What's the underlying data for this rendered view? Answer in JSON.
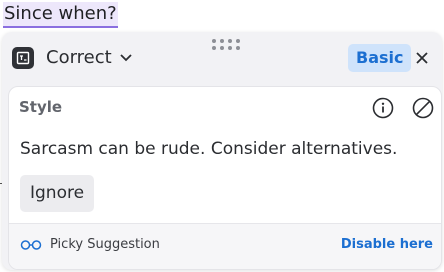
{
  "source_text": "Since when?",
  "popup": {
    "mode_label": "Correct",
    "mode_icon": "writing-tool-icon",
    "plan_badge": "Basic",
    "card": {
      "title": "Style",
      "message": "Sarcasm can be rude. Consider alternatives.",
      "ignore_label": "Ignore",
      "icons": [
        "info-icon",
        "disable-icon"
      ]
    },
    "footer": {
      "label": "Picky Suggestion",
      "icon": "glasses-icon",
      "link": "Disable here"
    }
  },
  "colors": {
    "highlight": "#ede7fb",
    "underline": "#8b6fe0",
    "accent": "#1c6fd1",
    "badge_bg": "#cfe3fb"
  }
}
